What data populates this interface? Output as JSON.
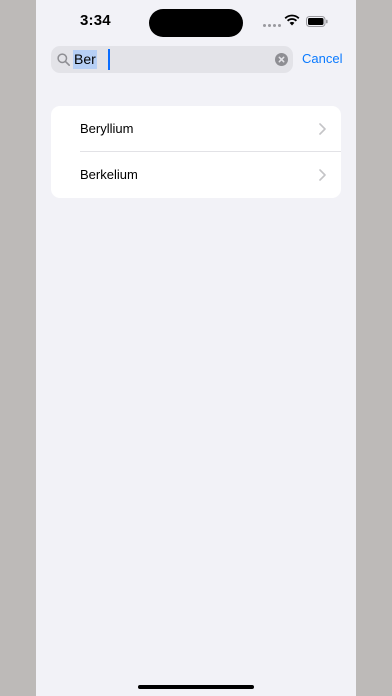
{
  "status_bar": {
    "time": "3:34",
    "signal_icon": "cellular-dots-icon",
    "wifi_icon": "wifi-icon",
    "battery_icon": "battery-icon"
  },
  "search": {
    "value": "Ber",
    "search_icon": "magnifying-glass-icon",
    "clear_icon": "clear-x-circle-icon",
    "cancel_label": "Cancel"
  },
  "results": {
    "items": [
      {
        "label": "Beryllium",
        "chevron": "chevron-right-icon"
      },
      {
        "label": "Berkelium",
        "chevron": "chevron-right-icon"
      }
    ]
  },
  "colors": {
    "accent": "#0a7aff",
    "background": "#f2f2f7",
    "selection": "#b6cff5"
  }
}
